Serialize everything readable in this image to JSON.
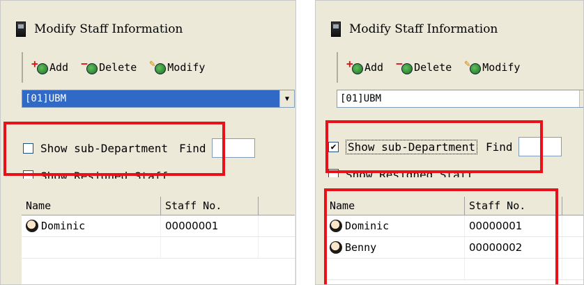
{
  "left": {
    "title": "Modify Staff Information",
    "toolbar": {
      "add": "Add",
      "delete": "Delete",
      "modify": "Modify"
    },
    "department": "[01]UBM",
    "show_sub_department": {
      "label": "Show sub-Department",
      "checked": false
    },
    "find_label": "Find",
    "show_resigned": {
      "label": "Show Resigned Staff"
    },
    "columns": {
      "name": "Name",
      "staff_no": "Staff No."
    },
    "rows": [
      {
        "name": "Dominic",
        "staff_no": "00000001"
      }
    ]
  },
  "right": {
    "title": "Modify Staff Information",
    "toolbar": {
      "add": "Add",
      "delete": "Delete",
      "modify": "Modify"
    },
    "department": "[01]UBM",
    "show_sub_department": {
      "label": "Show sub-Department",
      "checked": true,
      "mark": "✔"
    },
    "find_label": "Find",
    "show_resigned": {
      "label": "Show Resigned Staff"
    },
    "columns": {
      "name": "Name",
      "staff_no": "Staff No."
    },
    "rows": [
      {
        "name": "Dominic",
        "staff_no": "00000001"
      },
      {
        "name": "Benny",
        "staff_no": "00000002"
      }
    ]
  },
  "colors": {
    "highlight": "#e8111a",
    "selection": "#3169c6"
  }
}
